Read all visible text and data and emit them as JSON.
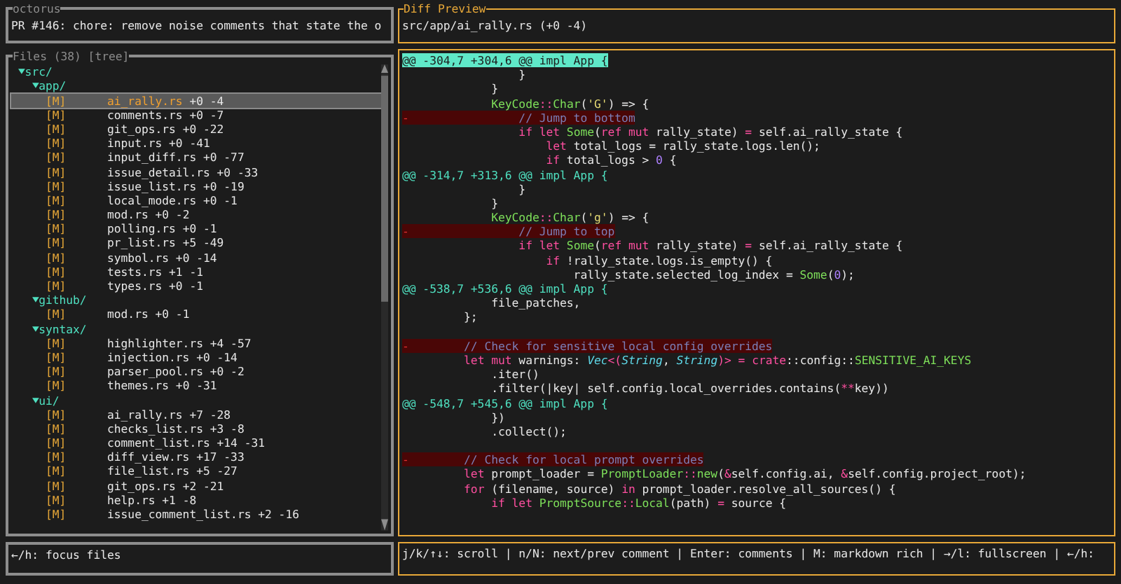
{
  "header": {
    "title": "octorus",
    "pr_title": "PR #146: chore: remove noise comments that state the o"
  },
  "files": {
    "title": "Files (38) [tree]",
    "tree": [
      {
        "name": "src/",
        "expanded": true,
        "children": [
          {
            "name": "app/",
            "expanded": true,
            "children": [
              {
                "status": "[M]",
                "name": "ai_rally.rs",
                "stats": "+0 -4",
                "selected": true
              },
              {
                "status": "[M]",
                "name": "comments.rs",
                "stats": "+0 -7",
                "selected": false
              },
              {
                "status": "[M]",
                "name": "git_ops.rs",
                "stats": "+0 -22",
                "selected": false
              },
              {
                "status": "[M]",
                "name": "input.rs",
                "stats": "+0 -41",
                "selected": false
              },
              {
                "status": "[M]",
                "name": "input_diff.rs",
                "stats": "+0 -77",
                "selected": false
              },
              {
                "status": "[M]",
                "name": "issue_detail.rs",
                "stats": "+0 -33",
                "selected": false
              },
              {
                "status": "[M]",
                "name": "issue_list.rs",
                "stats": "+0 -19",
                "selected": false
              },
              {
                "status": "[M]",
                "name": "local_mode.rs",
                "stats": "+0 -1",
                "selected": false
              },
              {
                "status": "[M]",
                "name": "mod.rs",
                "stats": "+0 -2",
                "selected": false
              },
              {
                "status": "[M]",
                "name": "polling.rs",
                "stats": "+0 -1",
                "selected": false
              },
              {
                "status": "[M]",
                "name": "pr_list.rs",
                "stats": "+5 -49",
                "selected": false
              },
              {
                "status": "[M]",
                "name": "symbol.rs",
                "stats": "+0 -14",
                "selected": false
              },
              {
                "status": "[M]",
                "name": "tests.rs",
                "stats": "+1 -1",
                "selected": false
              },
              {
                "status": "[M]",
                "name": "types.rs",
                "stats": "+0 -1",
                "selected": false
              }
            ]
          },
          {
            "name": "github/",
            "expanded": true,
            "children": [
              {
                "status": "[M]",
                "name": "mod.rs",
                "stats": "+0 -1",
                "selected": false
              }
            ]
          },
          {
            "name": "syntax/",
            "expanded": true,
            "children": [
              {
                "status": "[M]",
                "name": "highlighter.rs",
                "stats": "+4 -57",
                "selected": false
              },
              {
                "status": "[M]",
                "name": "injection.rs",
                "stats": "+0 -14",
                "selected": false
              },
              {
                "status": "[M]",
                "name": "parser_pool.rs",
                "stats": "+0 -2",
                "selected": false
              },
              {
                "status": "[M]",
                "name": "themes.rs",
                "stats": "+0 -31",
                "selected": false
              }
            ]
          },
          {
            "name": "ui/",
            "expanded": true,
            "children": [
              {
                "status": "[M]",
                "name": "ai_rally.rs",
                "stats": "+7 -28",
                "selected": false
              },
              {
                "status": "[M]",
                "name": "checks_list.rs",
                "stats": "+3 -8",
                "selected": false
              },
              {
                "status": "[M]",
                "name": "comment_list.rs",
                "stats": "+14 -31",
                "selected": false
              },
              {
                "status": "[M]",
                "name": "diff_view.rs",
                "stats": "+17 -33",
                "selected": false
              },
              {
                "status": "[M]",
                "name": "file_list.rs",
                "stats": "+5 -27",
                "selected": false
              },
              {
                "status": "[M]",
                "name": "git_ops.rs",
                "stats": "+2 -21",
                "selected": false
              },
              {
                "status": "[M]",
                "name": "help.rs",
                "stats": "+1 -8",
                "selected": false
              },
              {
                "status": "[M]",
                "name": "issue_comment_list.rs",
                "stats": "+2 -16",
                "selected": false
              }
            ]
          }
        ]
      }
    ]
  },
  "preview": {
    "title": "Diff Preview",
    "file": "src/app/ai_rally.rs (+0 -4)"
  },
  "diff": [
    {
      "kind": "hunk",
      "selected": true,
      "text": "@@ -304,7 +304,6 @@ impl App {"
    },
    {
      "kind": "context",
      "tokens": [
        {
          "t": "                }",
          "kind": "plain"
        }
      ]
    },
    {
      "kind": "context",
      "tokens": [
        {
          "t": "            }",
          "kind": "plain"
        }
      ]
    },
    {
      "kind": "context",
      "tokens": [
        {
          "t": "            KeyCode",
          "kind": "type"
        },
        {
          "t": "::",
          "kind": "keyword"
        },
        {
          "t": "Char",
          "kind": "type"
        },
        {
          "t": "(",
          "kind": "plain"
        },
        {
          "t": "'G'",
          "kind": "string"
        },
        {
          "t": ") => {",
          "kind": "plain"
        }
      ]
    },
    {
      "kind": "removed",
      "gutter": "-",
      "tokens": [
        {
          "t": "                // Jump to bottom",
          "kind": "comment"
        }
      ]
    },
    {
      "kind": "context",
      "tokens": [
        {
          "t": "                if let",
          "kind": "keyword"
        },
        {
          "t": " Some",
          "kind": "type"
        },
        {
          "t": "(",
          "kind": "plain"
        },
        {
          "t": "ref mut",
          "kind": "keyword"
        },
        {
          "t": " rally_state) ",
          "kind": "plain"
        },
        {
          "t": "=",
          "kind": "keyword"
        },
        {
          "t": " self.ai_rally_state {",
          "kind": "plain"
        }
      ]
    },
    {
      "kind": "context",
      "tokens": [
        {
          "t": "                    let",
          "kind": "keyword"
        },
        {
          "t": " total_logs = rally_state.logs.len();",
          "kind": "plain"
        }
      ]
    },
    {
      "kind": "context",
      "tokens": [
        {
          "t": "                    if",
          "kind": "keyword"
        },
        {
          "t": " total_logs > ",
          "kind": "plain"
        },
        {
          "t": "0",
          "kind": "number"
        },
        {
          "t": " {",
          "kind": "plain"
        }
      ]
    },
    {
      "kind": "hunk",
      "selected": false,
      "text": "@@ -314,7 +313,6 @@ impl App {"
    },
    {
      "kind": "context",
      "tokens": [
        {
          "t": "                }",
          "kind": "plain"
        }
      ]
    },
    {
      "kind": "context",
      "tokens": [
        {
          "t": "            }",
          "kind": "plain"
        }
      ]
    },
    {
      "kind": "context",
      "tokens": [
        {
          "t": "            KeyCode",
          "kind": "type"
        },
        {
          "t": "::",
          "kind": "keyword"
        },
        {
          "t": "Char",
          "kind": "type"
        },
        {
          "t": "(",
          "kind": "plain"
        },
        {
          "t": "'g'",
          "kind": "string"
        },
        {
          "t": ") => {",
          "kind": "plain"
        }
      ]
    },
    {
      "kind": "removed",
      "gutter": "-",
      "tokens": [
        {
          "t": "                // Jump to top",
          "kind": "comment"
        }
      ]
    },
    {
      "kind": "context",
      "tokens": [
        {
          "t": "                if let",
          "kind": "keyword"
        },
        {
          "t": " Some",
          "kind": "type"
        },
        {
          "t": "(",
          "kind": "plain"
        },
        {
          "t": "ref mut",
          "kind": "keyword"
        },
        {
          "t": " rally_state) ",
          "kind": "plain"
        },
        {
          "t": "=",
          "kind": "keyword"
        },
        {
          "t": " self.ai_rally_state {",
          "kind": "plain"
        }
      ]
    },
    {
      "kind": "context",
      "tokens": [
        {
          "t": "                    if",
          "kind": "keyword"
        },
        {
          "t": " !rally_state.logs.is_empty() {",
          "kind": "plain"
        }
      ]
    },
    {
      "kind": "context",
      "tokens": [
        {
          "t": "                        rally_state.selected_log_index = ",
          "kind": "plain"
        },
        {
          "t": "Some",
          "kind": "type"
        },
        {
          "t": "(",
          "kind": "plain"
        },
        {
          "t": "0",
          "kind": "number"
        },
        {
          "t": ");",
          "kind": "plain"
        }
      ]
    },
    {
      "kind": "hunk",
      "selected": false,
      "text": "@@ -538,7 +536,6 @@ impl App {"
    },
    {
      "kind": "context",
      "tokens": [
        {
          "t": "            file_patches,",
          "kind": "plain"
        }
      ]
    },
    {
      "kind": "context",
      "tokens": [
        {
          "t": "        };",
          "kind": "plain"
        }
      ]
    },
    {
      "kind": "blank"
    },
    {
      "kind": "removed",
      "gutter": "-",
      "tokens": [
        {
          "t": "        // Check for sensitive local config overrides",
          "kind": "comment"
        }
      ]
    },
    {
      "kind": "context",
      "tokens": [
        {
          "t": "        let mut",
          "kind": "keyword"
        },
        {
          "t": " warnings: ",
          "kind": "plain"
        },
        {
          "t": "Vec",
          "kind": "italic"
        },
        {
          "t": "<(",
          "kind": "keyword"
        },
        {
          "t": "String",
          "kind": "italic"
        },
        {
          "t": ", ",
          "kind": "plain"
        },
        {
          "t": "String",
          "kind": "italic"
        },
        {
          "t": ")> =",
          "kind": "keyword"
        },
        {
          "t": " crate",
          "kind": "keyword"
        },
        {
          "t": "::config::",
          "kind": "plain"
        },
        {
          "t": "SENSITIVE_AI_KEYS",
          "kind": "type"
        }
      ]
    },
    {
      "kind": "context",
      "tokens": [
        {
          "t": "            .iter()",
          "kind": "plain"
        }
      ]
    },
    {
      "kind": "context",
      "tokens": [
        {
          "t": "            .filter(|key| self.config.local_overrides.contains(",
          "kind": "plain"
        },
        {
          "t": "**",
          "kind": "keyword"
        },
        {
          "t": "key))",
          "kind": "plain"
        }
      ]
    },
    {
      "kind": "hunk",
      "selected": false,
      "text": "@@ -548,7 +545,6 @@ impl App {"
    },
    {
      "kind": "context",
      "tokens": [
        {
          "t": "            })",
          "kind": "plain"
        }
      ]
    },
    {
      "kind": "context",
      "tokens": [
        {
          "t": "            .collect();",
          "kind": "plain"
        }
      ]
    },
    {
      "kind": "blank"
    },
    {
      "kind": "removed",
      "gutter": "-",
      "tokens": [
        {
          "t": "        // Check for local prompt overrides",
          "kind": "comment"
        }
      ]
    },
    {
      "kind": "context",
      "tokens": [
        {
          "t": "        let",
          "kind": "keyword"
        },
        {
          "t": " prompt_loader = ",
          "kind": "plain"
        },
        {
          "t": "PromptLoader",
          "kind": "type"
        },
        {
          "t": "::",
          "kind": "keyword"
        },
        {
          "t": "new",
          "kind": "type"
        },
        {
          "t": "(",
          "kind": "plain"
        },
        {
          "t": "&",
          "kind": "keyword"
        },
        {
          "t": "self.config.ai, ",
          "kind": "plain"
        },
        {
          "t": "&",
          "kind": "keyword"
        },
        {
          "t": "self.config.project_root);",
          "kind": "plain"
        }
      ]
    },
    {
      "kind": "context",
      "tokens": [
        {
          "t": "        for",
          "kind": "keyword"
        },
        {
          "t": " (filename, source) ",
          "kind": "plain"
        },
        {
          "t": "in",
          "kind": "keyword"
        },
        {
          "t": " prompt_loader.resolve_all_sources() {",
          "kind": "plain"
        }
      ]
    },
    {
      "kind": "context",
      "tokens": [
        {
          "t": "            if let",
          "kind": "keyword"
        },
        {
          "t": " PromptSource",
          "kind": "type"
        },
        {
          "t": "::",
          "kind": "keyword"
        },
        {
          "t": "Local",
          "kind": "type"
        },
        {
          "t": "(path) ",
          "kind": "plain"
        },
        {
          "t": "=",
          "kind": "keyword"
        },
        {
          "t": " source {",
          "kind": "plain"
        }
      ]
    }
  ],
  "status_left": "←/h: focus files",
  "status_right": "j/k/↑↓: scroll | n/N: next/prev comment | Enter: comments | M: markdown rich | →/l: fullscreen | ←/h:"
}
